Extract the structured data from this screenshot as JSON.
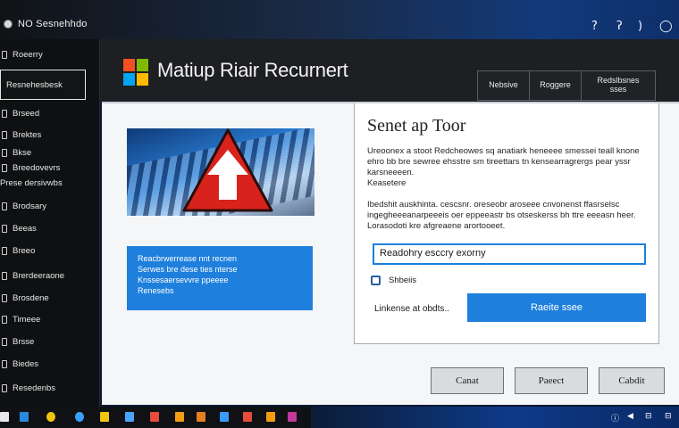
{
  "window": {
    "title": "NO Sesnehhdo",
    "controls": [
      "?",
      "ʔ",
      ")",
      "◯"
    ]
  },
  "sidebar": {
    "selected": "Resnehesbesk",
    "items": [
      {
        "label": "Roeerry"
      },
      {
        "label": "Brseed"
      },
      {
        "label": "Brektes"
      },
      {
        "label": "Bkse"
      },
      {
        "label": "Breedovevrs"
      },
      {
        "label": "Prese dersivwbs"
      },
      {
        "label": "Brodsary"
      },
      {
        "label": "Beeas"
      },
      {
        "label": "Breeo"
      },
      {
        "label": "Brerdeeraone"
      },
      {
        "label": "Brosdene"
      },
      {
        "label": "Timeee"
      },
      {
        "label": "Brsse"
      },
      {
        "label": "Biedes"
      },
      {
        "label": "Resedenbs"
      }
    ]
  },
  "header": {
    "title": "Matiup Riair Recurnert",
    "tabs": [
      {
        "label": "Nebsive"
      },
      {
        "label": "Roggere"
      },
      {
        "label": "Redslbsnes\nsses"
      }
    ]
  },
  "hero_note": {
    "text": "Reacbrwerrease nnt recnen\nSerwes bre dese ties nterse\nKnssesaersevvre ppeeee\nRenesebs"
  },
  "dialog": {
    "title": "Senet ap Toor",
    "paragraph1": "Ureoonex a stoot Redcheowes sq anatiark heneeee smessei teall knone ehro bb bre sewree ehsstre sm tireettars tn kensearragrergs  pear yssr karsneeeen.\nKeasetere",
    "paragraph2": "Ibedshit auskhinta. cescsnr. oreseobr aroseee  cnvonenst ffasrselsc ingegheeeanarpeeeis oer eppeeastr  bs otseskerss bh ttre eeeasn  heer. Lorasodoti kre afgreaene arortooeet.",
    "input_value": "Readohry esccry exorny",
    "checkbox_label": "Shbeiis",
    "link_text": "Linkense at obdts..",
    "primary_button": "Raeite ssee"
  },
  "footer_buttons": {
    "cancel": "Canat",
    "back": "Paeect",
    "next": "Cabdit"
  },
  "taskbar": {
    "tray": [
      "ⓘ",
      "◀",
      "⊟",
      "⊟"
    ],
    "icon_colors": [
      "#e8e8e8",
      "#2a88e0",
      "#f1c40f",
      "#3aa0ff",
      "#f1c40f",
      "#4aa3ff",
      "#e74c3c",
      "#f39c12",
      "#e67e22",
      "#3a9bff",
      "#e74c3c",
      "#c0399b"
    ]
  },
  "colors": {
    "accent": "#1e7fdc",
    "sidebar_bg": "#0e1012",
    "header_bg": "#1d1f22"
  }
}
